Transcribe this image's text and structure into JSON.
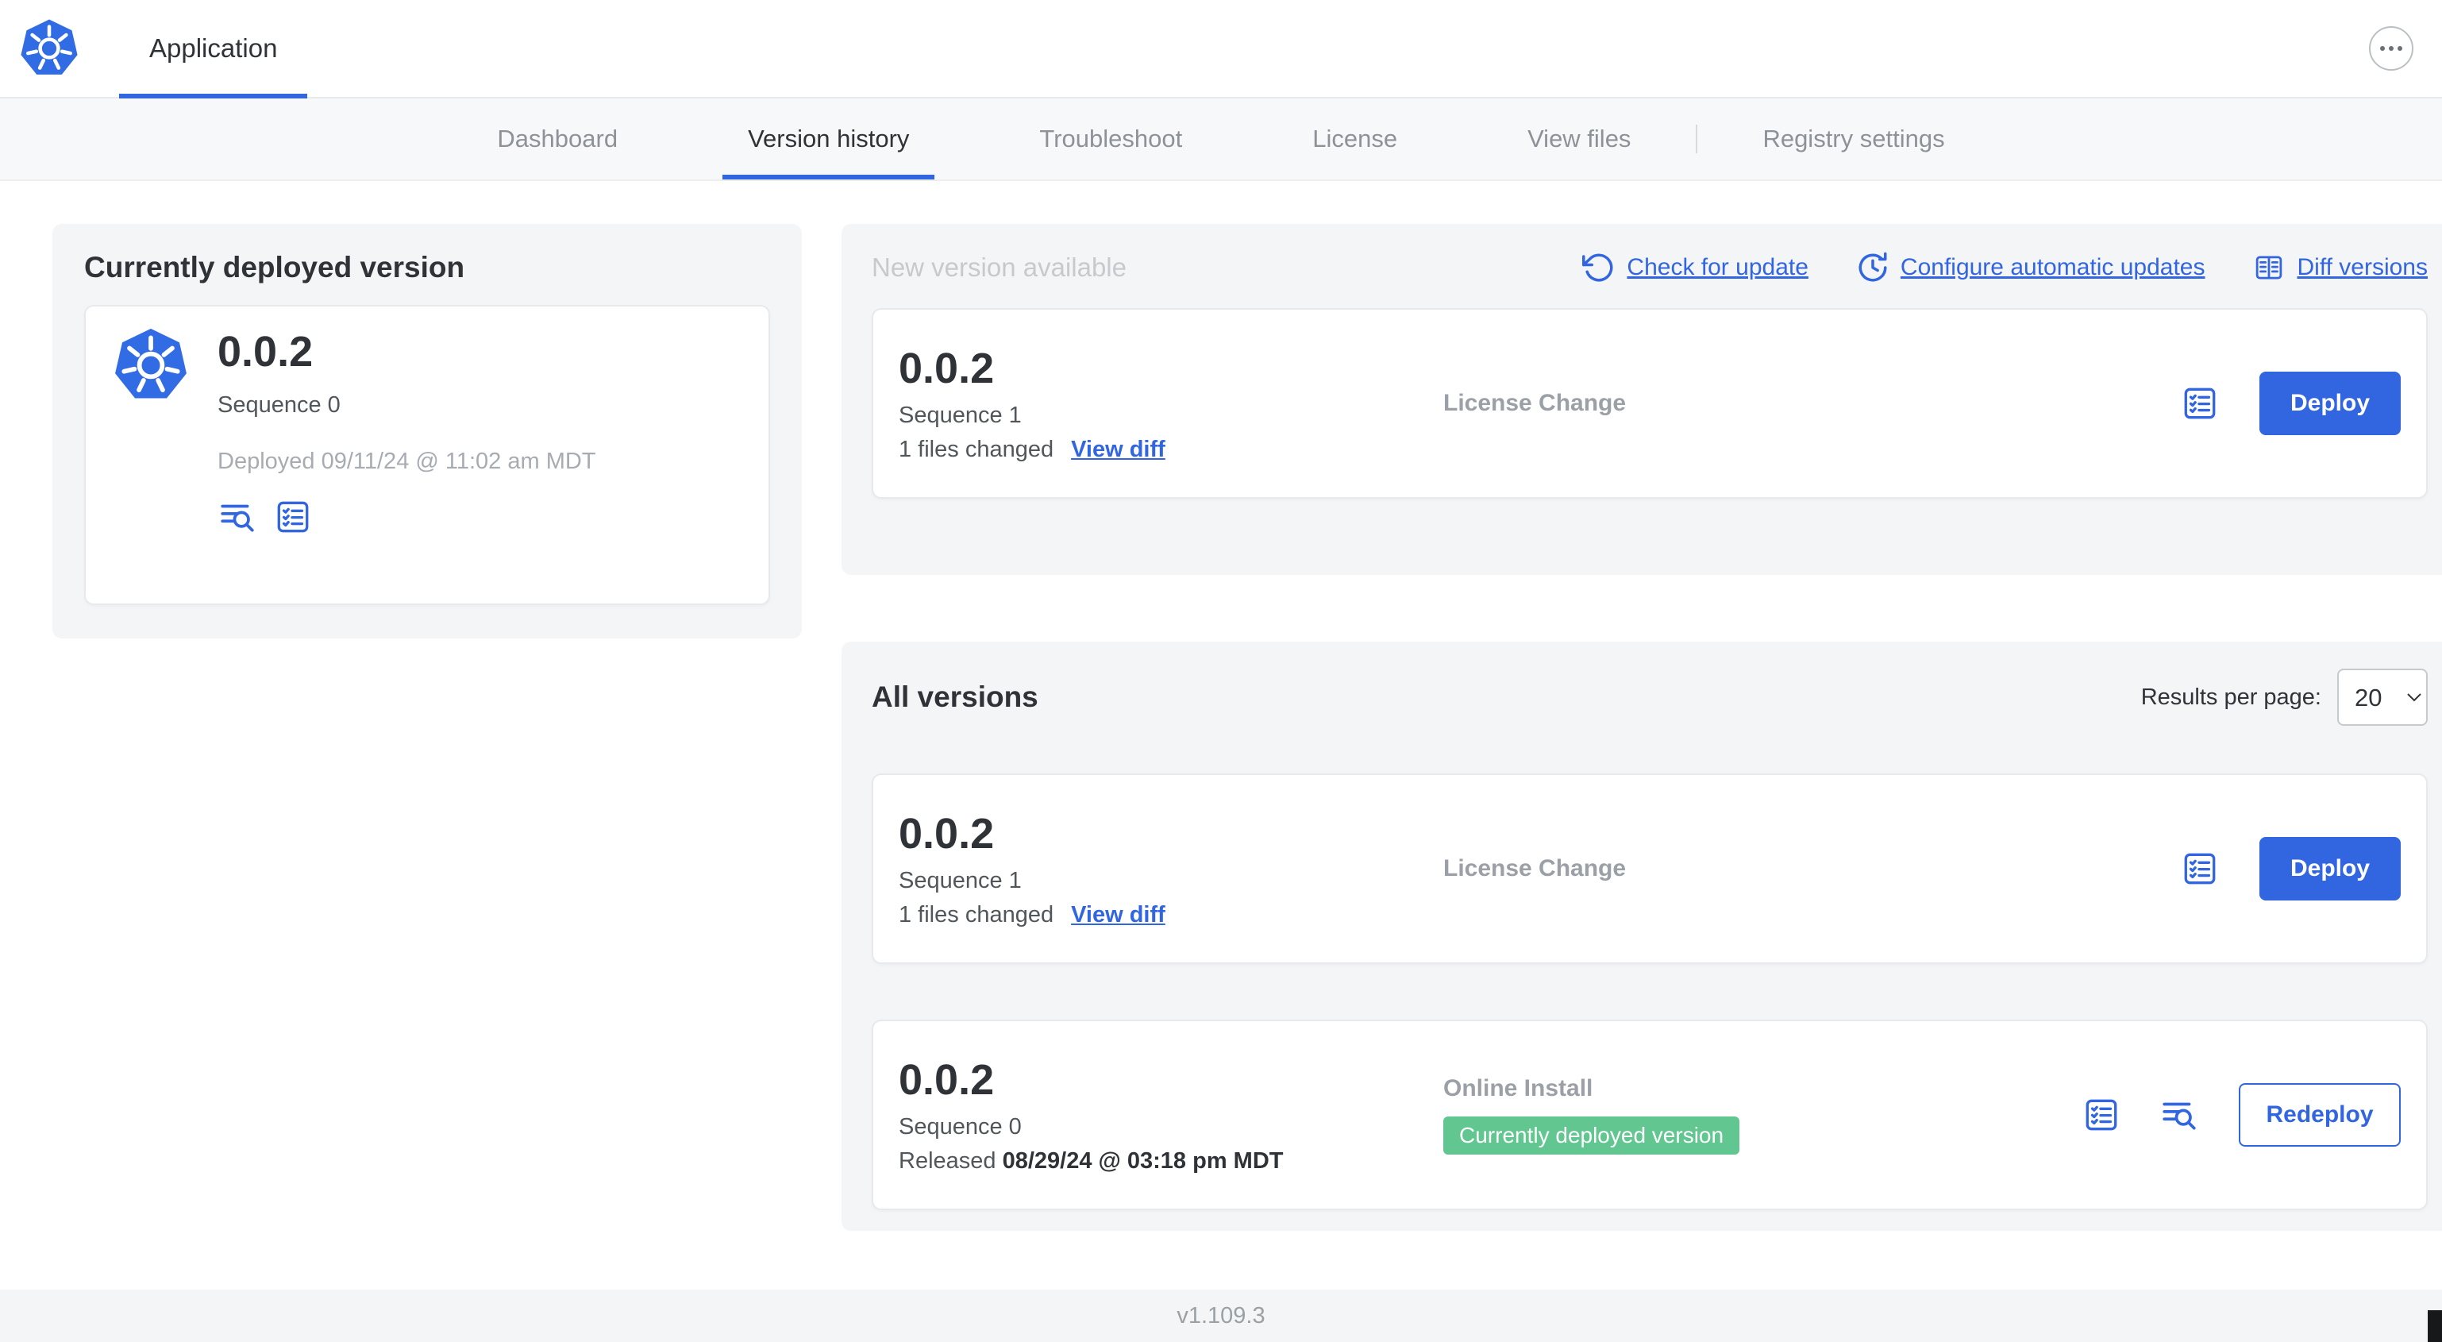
{
  "header": {
    "app_tab": "Application"
  },
  "nav": {
    "tabs": [
      "Dashboard",
      "Version history",
      "Troubleshoot",
      "License",
      "View files",
      "Registry settings"
    ]
  },
  "current": {
    "title": "Currently deployed version",
    "version": "0.0.2",
    "sequence": "Sequence 0",
    "deployed": "Deployed 09/11/24 @ 11:02 am MDT"
  },
  "new_version": {
    "title": "New version available",
    "check_for_update": "Check for update",
    "configure_updates": "Configure automatic updates",
    "diff_versions": "Diff versions",
    "card": {
      "version": "0.0.2",
      "sequence": "Sequence 1",
      "files_changed": "1 files changed",
      "view_diff": "View diff",
      "source": "License Change",
      "action": "Deploy"
    }
  },
  "all_versions": {
    "title": "All versions",
    "per_page_label": "Results per page:",
    "per_page_value": "20",
    "rows": [
      {
        "version": "0.0.2",
        "sequence": "Sequence 1",
        "files_changed": "1 files changed",
        "view_diff": "View diff",
        "source": "License Change",
        "action": "Deploy"
      },
      {
        "version": "0.0.2",
        "sequence": "Sequence 0",
        "released_label": "Released",
        "released_date": "08/29/24 @ 03:18 pm MDT",
        "source": "Online Install",
        "badge": "Currently deployed version",
        "action": "Redeploy"
      }
    ]
  },
  "footer": {
    "app_version": "v1.109.3"
  },
  "colors": {
    "accent": "#3265e0",
    "green": "#61c690",
    "logo_blue": "#326CE5"
  }
}
